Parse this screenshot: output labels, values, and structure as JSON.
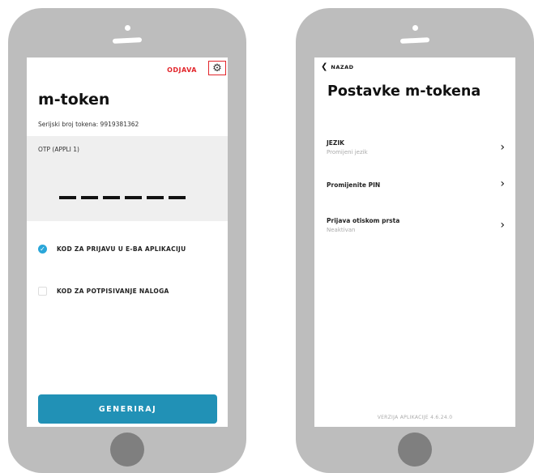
{
  "left_screen": {
    "logout_label": "ODJAVA",
    "settings_icon": "gear-icon",
    "title": "m-token",
    "serial": "Serijski broj tokena: 9919381362",
    "otp_label": "OTP (APPLI 1)",
    "otp_placeholder_count": 6,
    "options": [
      {
        "label": "KOD ZA PRIJAVU U E-BA APLIKACIJU",
        "checked": true
      },
      {
        "label": "KOD ZA POTPISIVANJE NALOGA",
        "checked": false
      }
    ],
    "generate_label": "GENERIRAJ"
  },
  "right_screen": {
    "back_label": "NAZAD",
    "title": "Postavke m-tokena",
    "items": [
      {
        "label": "JEZIK",
        "sub": "Promijeni jezik"
      },
      {
        "label": "Promijenite PIN",
        "sub": ""
      },
      {
        "label": "Prijava otiskom prsta",
        "sub": "Neaktivan"
      }
    ],
    "version": "VERZIJA APLIKACIJE 4.6.24.0"
  },
  "colors": {
    "accent_red": "#e2252b",
    "button_blue": "#2191b6",
    "check_blue": "#2aa6d9",
    "phone_body": "#bdbdbd"
  }
}
